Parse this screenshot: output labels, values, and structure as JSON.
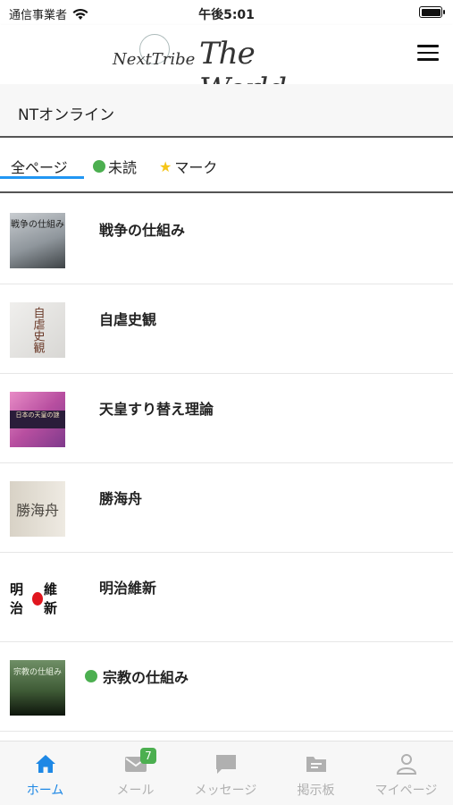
{
  "status_bar": {
    "carrier": "通信事業者",
    "time": "午後5:01"
  },
  "header": {
    "logo_sub": "NextTribe",
    "logo_main": "The World"
  },
  "section": {
    "title": "NTオンライン"
  },
  "tabs": [
    {
      "label": "全ページ",
      "active": true
    },
    {
      "label": "未読",
      "icon": "green-dot-icon"
    },
    {
      "label": "マーク",
      "icon": "star-icon"
    }
  ],
  "articles": [
    {
      "title": "戦争の仕組み",
      "thumb_text": "戦争の仕組み",
      "unread": false
    },
    {
      "title": "自虐史観",
      "thumb_text": "自虐史観",
      "unread": false
    },
    {
      "title": "天皇すり替え理論",
      "thumb_text": "日本の天皇の謎",
      "unread": false
    },
    {
      "title": "勝海舟",
      "thumb_text": "勝海舟",
      "unread": false
    },
    {
      "title": "明治維新",
      "thumb_text_left": "明治",
      "thumb_text_right": "維新",
      "unread": false
    },
    {
      "title": "宗教の仕組み",
      "thumb_text": "宗教の仕組み",
      "unread": true
    }
  ],
  "bottom_nav": [
    {
      "label": "ホーム",
      "icon": "home-icon",
      "active": true
    },
    {
      "label": "メール",
      "icon": "mail-icon",
      "badge": "7"
    },
    {
      "label": "メッセージ",
      "icon": "chat-icon"
    },
    {
      "label": "掲示板",
      "icon": "board-icon"
    },
    {
      "label": "マイページ",
      "icon": "person-icon"
    }
  ],
  "colors": {
    "accent": "#1e88e5",
    "unread": "#4caf50",
    "star": "#f5c518",
    "inactive": "#b0b0b0"
  }
}
